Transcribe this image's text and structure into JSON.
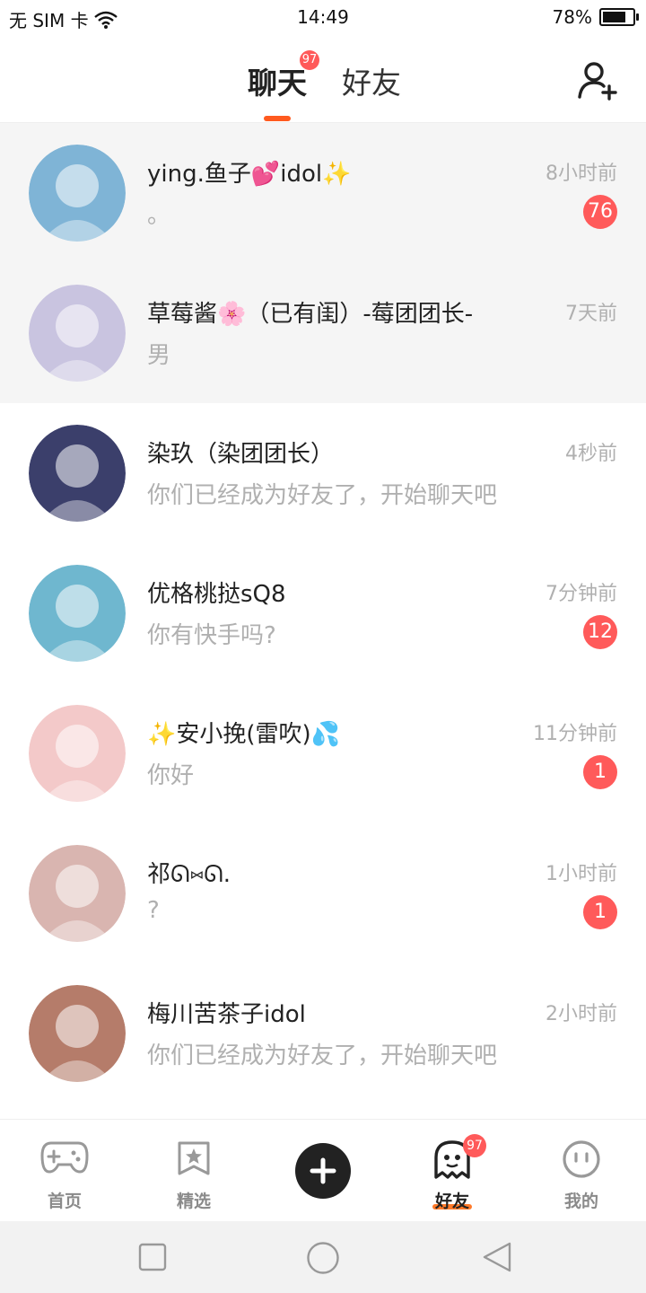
{
  "status": {
    "carrier": "无 SIM 卡",
    "time": "14:49",
    "battery": "78%",
    "battery_level": 0.78
  },
  "header": {
    "tab_chat": "聊天",
    "tab_friends": "好友",
    "chat_badge": "97"
  },
  "chats": [
    {
      "name": "ying.鱼子💕idol✨",
      "preview": "。",
      "time": "8小时前",
      "unread": "76",
      "avatar_color": "#7fb4d6",
      "highlight": true
    },
    {
      "name": "草莓酱🌸（已有闺）-莓团团长-",
      "preview": "男",
      "time": "7天前",
      "unread": "",
      "avatar_color": "#c9c4e0",
      "highlight": true
    },
    {
      "name": "染玖（染团团长）",
      "preview": "你们已经成为好友了，开始聊天吧",
      "time": "4秒前",
      "unread": "",
      "avatar_color": "#3b3f6b",
      "highlight": false
    },
    {
      "name": "优格桃挞sQ8",
      "preview": "你有快手吗?",
      "time": "7分钟前",
      "unread": "12",
      "avatar_color": "#6fb7cf",
      "highlight": false
    },
    {
      "name": "✨安小挽(雷吹)💦",
      "preview": "你好",
      "time": "11分钟前",
      "unread": "1",
      "avatar_color": "#f3c9c9",
      "highlight": false
    },
    {
      "name": "祁ᘏ⑅ᘏ.",
      "preview": "?",
      "time": "1小时前",
      "unread": "1",
      "avatar_color": "#d9b5b0",
      "highlight": false
    },
    {
      "name": "梅川苦茶子idol",
      "preview": "你们已经成为好友了，开始聊天吧",
      "time": "2小时前",
      "unread": "",
      "avatar_color": "#b57c6a",
      "highlight": false
    }
  ],
  "bottom_nav": [
    {
      "label": "首页",
      "icon": "gamepad-icon",
      "active": false
    },
    {
      "label": "精选",
      "icon": "star-bookmark-icon",
      "active": false
    },
    {
      "label": "",
      "icon": "plus-icon",
      "active": false
    },
    {
      "label": "好友",
      "icon": "ghost-icon",
      "active": true
    },
    {
      "label": "我的",
      "icon": "face-icon",
      "active": false
    }
  ],
  "friends_badge": "97",
  "colors": {
    "accent": "#ff5a1f",
    "badge": "#ff5a5a",
    "underline": "#ff7a2a"
  }
}
